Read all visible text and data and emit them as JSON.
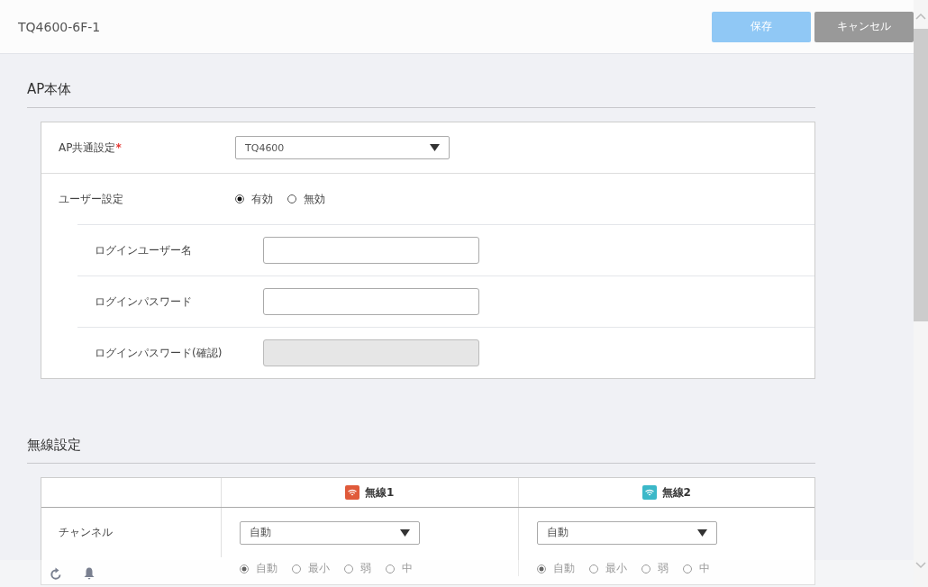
{
  "header": {
    "title": "TQ4600-6F-1",
    "buttons": [
      {
        "label": "保存",
        "kind": "primary",
        "disabled": true
      },
      {
        "label": "キャンセル",
        "kind": "secondary",
        "disabled": false
      }
    ]
  },
  "ap_section": {
    "title": "AP本体",
    "common": {
      "label": "AP共通設定",
      "required_mark": "*",
      "value": "TQ4600"
    },
    "user_setting": {
      "label": "ユーザー設定",
      "options": [
        {
          "label": "有効",
          "selected": true
        },
        {
          "label": "無効",
          "selected": false
        }
      ]
    },
    "fields": [
      {
        "label": "ログインユーザー名",
        "disabled": false
      },
      {
        "label": "ログインパスワード",
        "disabled": false
      },
      {
        "label": "ログインパスワード(確認)",
        "disabled": true
      }
    ]
  },
  "wireless_section": {
    "title": "無線設定",
    "columns": [
      {
        "label": "無線1",
        "color": "#e05a3a"
      },
      {
        "label": "無線2",
        "color": "#3bb8c8"
      }
    ],
    "rows": [
      {
        "kind": "select",
        "label": "チャンネル",
        "cells": [
          {
            "value": "自動"
          },
          {
            "value": "自動"
          }
        ]
      },
      {
        "kind": "radio",
        "cells": [
          {
            "options": [
              {
                "label": "自動",
                "selected": true
              },
              {
                "label": "最小",
                "selected": false
              },
              {
                "label": "弱",
                "selected": false
              },
              {
                "label": "中",
                "selected": false
              }
            ]
          },
          {
            "options": [
              {
                "label": "自動",
                "selected": true
              },
              {
                "label": "最小",
                "selected": false
              },
              {
                "label": "弱",
                "selected": false
              },
              {
                "label": "中",
                "selected": false
              }
            ]
          }
        ]
      }
    ]
  }
}
